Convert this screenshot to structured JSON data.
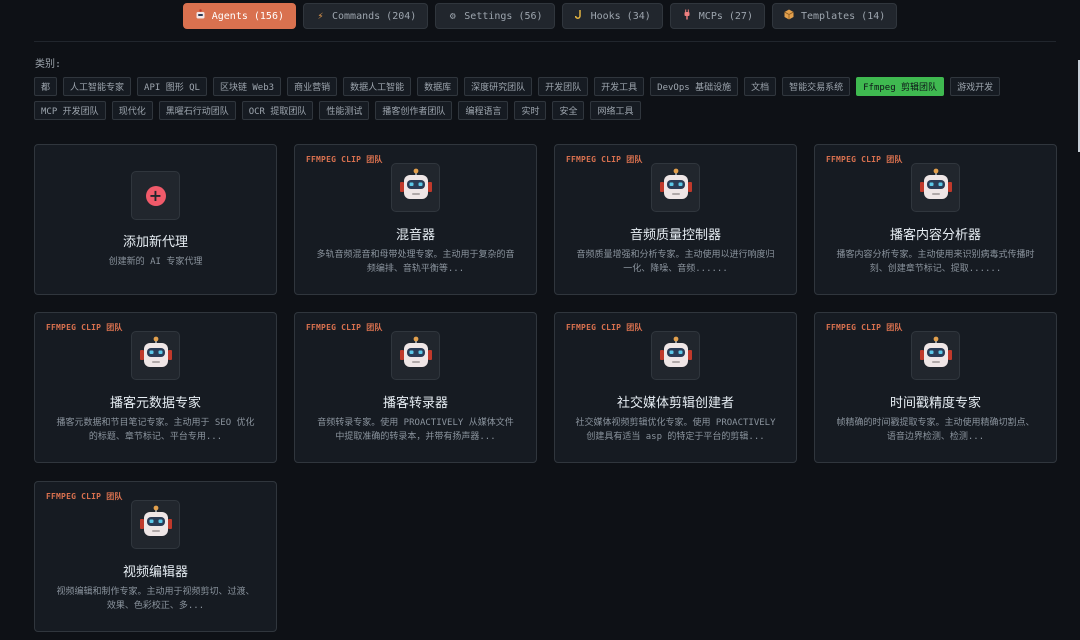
{
  "tabs": [
    {
      "label": "Agents (156)",
      "icon": "robot-icon",
      "active": true
    },
    {
      "label": "Commands (204)",
      "icon": "bolt-icon",
      "active": false
    },
    {
      "label": "Settings (56)",
      "icon": "gear-icon",
      "active": false
    },
    {
      "label": "Hooks (34)",
      "icon": "hook-icon",
      "active": false
    },
    {
      "label": "MCPs (27)",
      "icon": "plug-icon",
      "active": false
    },
    {
      "label": "Templates (14)",
      "icon": "package-icon",
      "active": false
    }
  ],
  "categories": {
    "label": "类别:",
    "row1": [
      "都",
      "人工智能专家",
      "API 图形 QL",
      "区块链 Web3",
      "商业营销",
      "数据人工智能",
      "数据库",
      "深度研究团队",
      "开发团队",
      "开发工具",
      "DevOps 基础设施",
      "文档",
      "智能交易系统",
      "Ffmpeg 剪辑团队",
      "游戏开发"
    ],
    "row2": [
      "MCP 开发团队",
      "现代化",
      "黑曜石行动团队",
      "OCR 提取团队",
      "性能测试",
      "播客创作者团队",
      "编程语言",
      "实时",
      "安全",
      "网络工具"
    ],
    "active": "Ffmpeg 剪辑团队"
  },
  "add_card": {
    "title": "添加新代理",
    "desc": "创建新的 AI 专家代理"
  },
  "cards": [
    {
      "tag": "FFMPEG CLIP 团队",
      "title": "混音器",
      "desc": "多轨音频混音和母带处理专家。主动用于复杂的音频编排、音轨平衡等..."
    },
    {
      "tag": "FFMPEG CLIP 团队",
      "title": "音频质量控制器",
      "desc": "音频质量增强和分析专家。主动使用以进行响度归一化、降噪、音频......"
    },
    {
      "tag": "FFMPEG CLIP 团队",
      "title": "播客内容分析器",
      "desc": "播客内容分析专家。主动使用来识别病毒式传播时刻、创建章节标记、提取......"
    },
    {
      "tag": "FFMPEG CLIP 团队",
      "title": "播客元数据专家",
      "desc": "播客元数据和节目笔记专家。主动用于 SEO 优化的标题、章节标记、平台专用..."
    },
    {
      "tag": "FFMPEG CLIP 团队",
      "title": "播客转录器",
      "desc": "音频转录专家。使用 PROACTIVELY 从媒体文件中提取准确的转录本，并带有扬声器..."
    },
    {
      "tag": "FFMPEG CLIP 团队",
      "title": "社交媒体剪辑创建者",
      "desc": "社交媒体视频剪辑优化专家。使用 PROACTIVELY 创建具有适当 asp 的特定于平台的剪辑..."
    },
    {
      "tag": "FFMPEG CLIP 团队",
      "title": "时间戳精度专家",
      "desc": "帧精确的时间戳提取专家。主动使用精确切割点、语音边界检测、检测..."
    },
    {
      "tag": "FFMPEG CLIP 团队",
      "title": "视频编辑器",
      "desc": "视频编辑和制作专家。主动用于视频剪切、过渡、效果、色彩校正、多..."
    }
  ]
}
